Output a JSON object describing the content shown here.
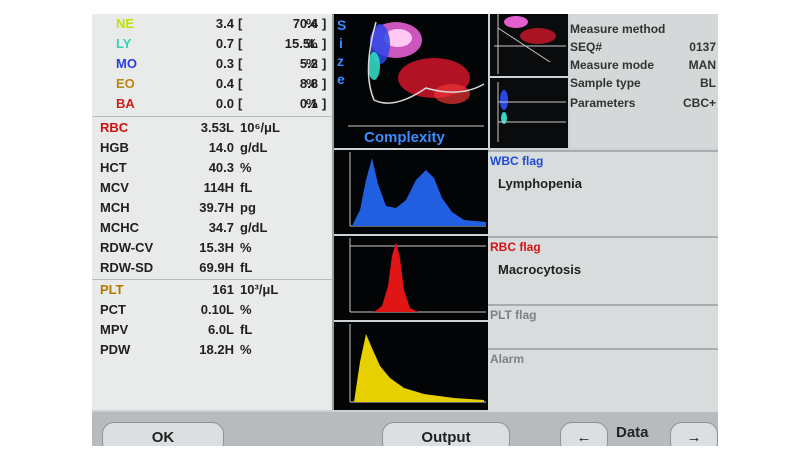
{
  "diff": [
    {
      "name": "NE",
      "value": "3.4",
      "pct": "70.4",
      "unit": "%",
      "color": "#c3e000"
    },
    {
      "name": "LY",
      "value": "0.7",
      "pct": "15.5L",
      "unit": "%",
      "color": "#36d1b8"
    },
    {
      "name": "MO",
      "value": "0.3",
      "pct": "5.2",
      "unit": "%",
      "color": "#2a3ee0"
    },
    {
      "name": "EO",
      "value": "0.4",
      "pct": "8.8",
      "unit": "%",
      "color": "#b8880a"
    },
    {
      "name": "BA",
      "value": "0.0",
      "pct": "0.1",
      "unit": "%",
      "color": "#cc2020"
    }
  ],
  "rbc": [
    {
      "name": "RBC",
      "value": "3.53L",
      "unit": "10⁶/μL",
      "color": "#cc1010"
    },
    {
      "name": "HGB",
      "value": "14.0",
      "unit": "g/dL"
    },
    {
      "name": "HCT",
      "value": "40.3",
      "unit": "%"
    },
    {
      "name": "MCV",
      "value": "114H",
      "unit": "fL"
    },
    {
      "name": "MCH",
      "value": "39.7H",
      "unit": "pg"
    },
    {
      "name": "MCHC",
      "value": "34.7",
      "unit": "g/dL"
    },
    {
      "name": "RDW-CV",
      "value": "15.3H",
      "unit": "%"
    },
    {
      "name": "RDW-SD",
      "value": "69.9H",
      "unit": "fL"
    }
  ],
  "plt": [
    {
      "name": "PLT",
      "value": "161",
      "unit": "10³/μL",
      "color": "#b07a00"
    },
    {
      "name": "PCT",
      "value": "0.10L",
      "unit": "%"
    },
    {
      "name": "MPV",
      "value": "6.0L",
      "unit": "fL"
    },
    {
      "name": "PDW",
      "value": "18.2H",
      "unit": "%"
    }
  ],
  "scatter": {
    "axis_label": "Complexity",
    "side_label": "Size"
  },
  "info": {
    "labels": [
      "Measure method",
      "SEQ#",
      "Measure mode",
      "Sample type",
      "Parameters"
    ],
    "values": [
      "",
      "0137",
      "MAN",
      "BL",
      "CBC+"
    ]
  },
  "flags": {
    "wbc_title": "WBC flag",
    "wbc_msg": "Lymphopenia",
    "rbc_title": "RBC flag",
    "rbc_msg": "Macrocytosis",
    "plt_title": "PLT flag",
    "alarm_title": "Alarm"
  },
  "buttons": {
    "ok": "OK",
    "output": "Output",
    "data": "Data",
    "prev": "←",
    "next": "→"
  },
  "colors": {
    "wbc_flag": "#1c4bd8",
    "rbc_flag": "#d41414",
    "muted": "#7d8184"
  }
}
